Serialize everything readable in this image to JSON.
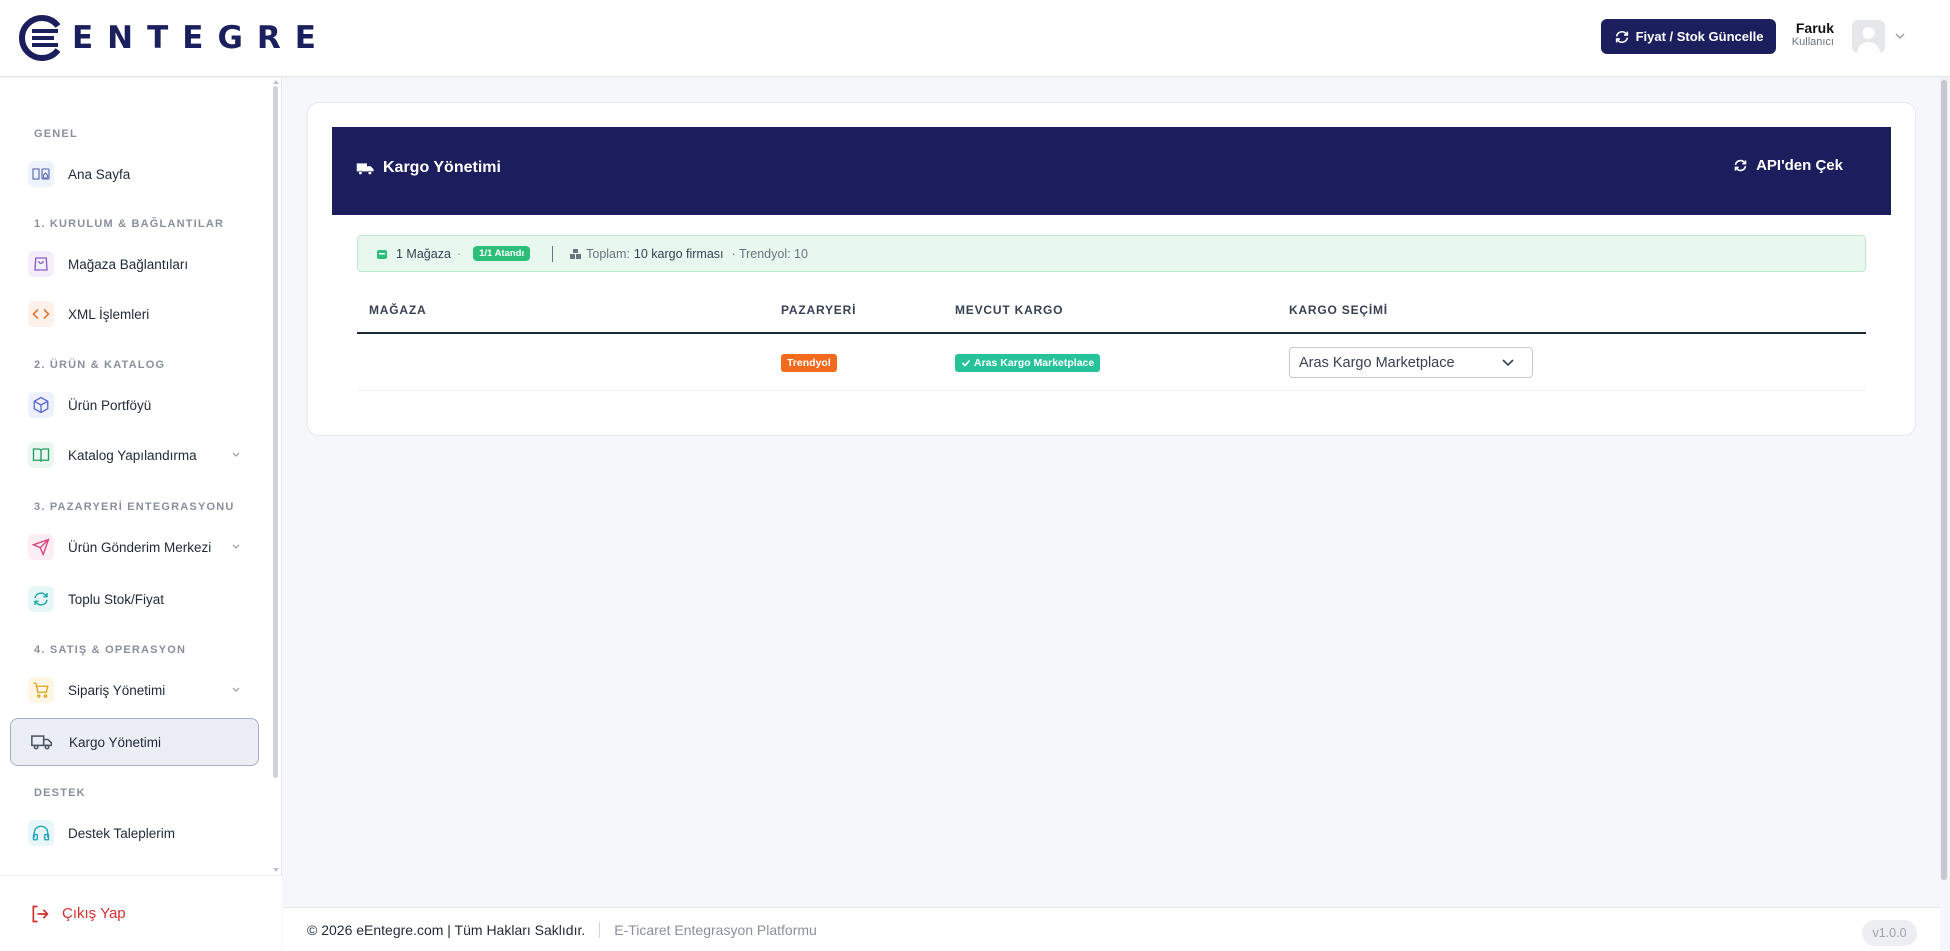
{
  "header": {
    "logo_text": "ENTEGRE",
    "sync_button": "Fiyat / Stok Güncelle",
    "user_name": "Faruk",
    "user_role": "Kullanıcı"
  },
  "sidebar": {
    "sections": [
      "GENEL",
      "1. KURULUM & BAĞLANTILAR",
      "2. ÜRÜN & KATALOG",
      "3. PAZARYERİ ENTEGRASYONU",
      "4. SATIŞ & OPERASYON",
      "DESTEK"
    ],
    "items": [
      {
        "label": "Ana Sayfa",
        "icon": "home-icon"
      },
      {
        "label": "Mağaza Bağlantıları",
        "icon": "shopping-bag-icon"
      },
      {
        "label": "XML İşlemleri",
        "icon": "code-icon"
      },
      {
        "label": "Ürün Portföyü",
        "icon": "box-icon"
      },
      {
        "label": "Katalog Yapılandırma",
        "icon": "book-icon"
      },
      {
        "label": "Ürün Gönderim Merkezi",
        "icon": "send-icon"
      },
      {
        "label": "Toplu Stok/Fiyat",
        "icon": "refresh-icon"
      },
      {
        "label": "Sipariş Yönetimi",
        "icon": "cart-icon"
      },
      {
        "label": "Kargo Yönetimi",
        "icon": "truck-icon"
      },
      {
        "label": "Destek Taleplerim",
        "icon": "headphones-icon"
      }
    ],
    "logout": "Çıkış Yap"
  },
  "panel": {
    "title": "Kargo Yönetimi",
    "api_button": "API'den Çek",
    "info": {
      "stores": "1 Mağaza",
      "assigned": "1/1 Atandı",
      "total_label": "Toplam:",
      "total_value": "10 kargo firması",
      "trendyol": "· Trendyol: 10"
    },
    "columns": [
      "MAĞAZA",
      "PAZARYERİ",
      "MEVCUT KARGO",
      "KARGO SEÇİMİ"
    ],
    "rows": [
      {
        "store": "",
        "marketplace": "Trendyol",
        "current_cargo": "Aras Kargo Marketplace",
        "selection": "Aras Kargo Marketplace"
      }
    ]
  },
  "footer": {
    "copyright": "© 2026 eEntegre.com | Tüm Hakları Saklıdır.",
    "platform": "E-Ticaret Entegrasyon Platformu",
    "version": "v1.0.0"
  },
  "colors": {
    "brand": "#1b1d5c",
    "marketplace_badge": "#f26a1b",
    "cargo_badge": "#26c39a",
    "logout": "#d32f2f"
  }
}
